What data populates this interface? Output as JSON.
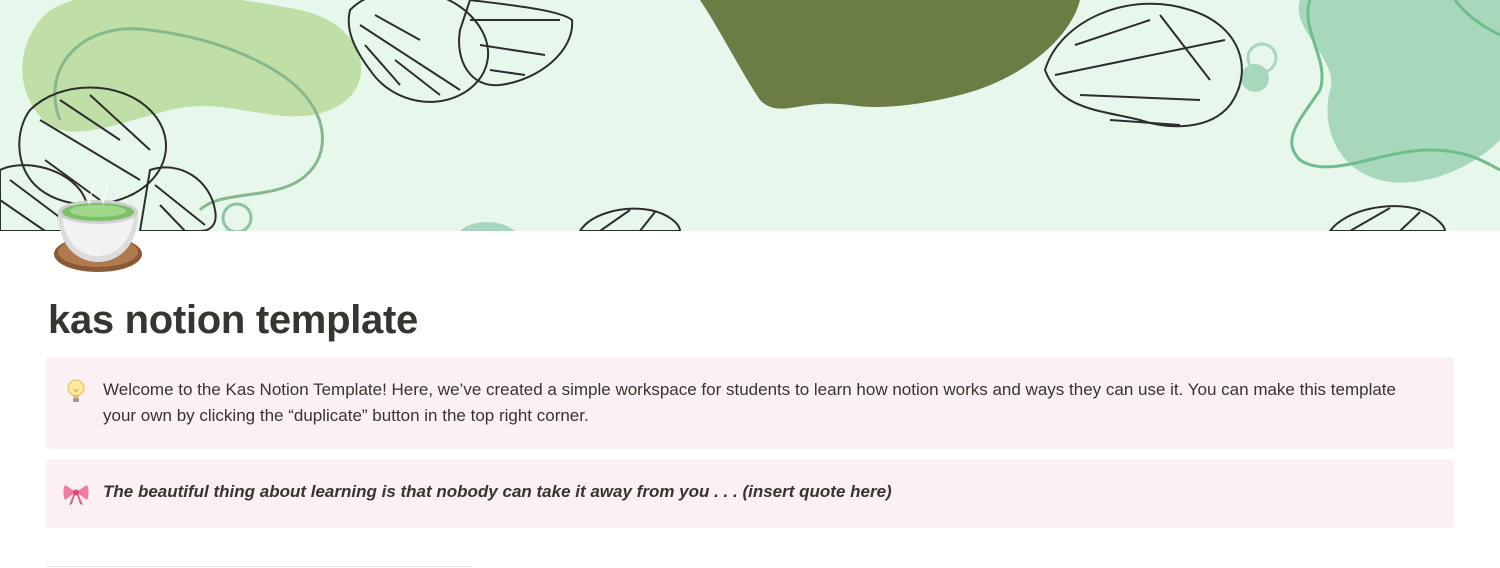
{
  "page": {
    "title": "kas notion template",
    "icon": "hot-tea-cup-icon"
  },
  "cover": {
    "description_icon": "monstera-leaves-cover",
    "colors": {
      "background": "#e8f7ec",
      "light_green": "#bfdfa6",
      "olive": "#6b7d44",
      "mint": "#a8d8bb",
      "line_green": "#6fbd8c"
    }
  },
  "callouts": [
    {
      "icon": "lightbulb-icon",
      "text": "Welcome to the Kas Notion Template! Here, we’ve created a simple workspace for students to learn how notion works and ways they can use it. You can make this template your own by clicking the “duplicate” button in the top right corner.",
      "background": "#fbf0f4"
    },
    {
      "icon": "ribbon-bow-icon",
      "text": "The beautiful thing about learning is that nobody can take it away from you . . . (insert quote here)",
      "background": "#fbf0f4"
    }
  ]
}
